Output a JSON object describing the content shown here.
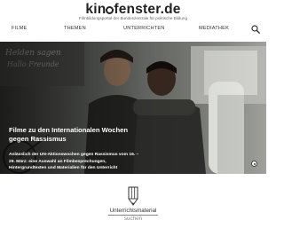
{
  "header": {
    "logo_text_part1": "kin",
    "logo_text_part2": "fenster.de",
    "tagline": "Filmbildungsportal der Bundeszentrale für politische Bildung"
  },
  "nav": {
    "items": [
      "FILME",
      "THEMEN",
      "UNTERRICHTEN",
      "MEDIATHEK"
    ],
    "search_icon": "search-icon"
  },
  "hero": {
    "title": "Filme zu den Internationalen Wochen gegen Rassismus",
    "text": "Anlässlich der UN-Aktionswochen gegen Rassismus vom 16. – 29. März: eine Auswahl an Filmbesprechungen, Hintergrundtexten und Materialien für den Unterricht",
    "wall_text": "Helden sagen\nHallo Freunde"
  },
  "teaser": {
    "icon": "pencil-icon",
    "label": "Unterrichtsmaterial",
    "sub": "suchen"
  },
  "colors": {
    "text": "#333333",
    "hero_overlay": "#3b3b3a",
    "background": "#ffffff"
  }
}
